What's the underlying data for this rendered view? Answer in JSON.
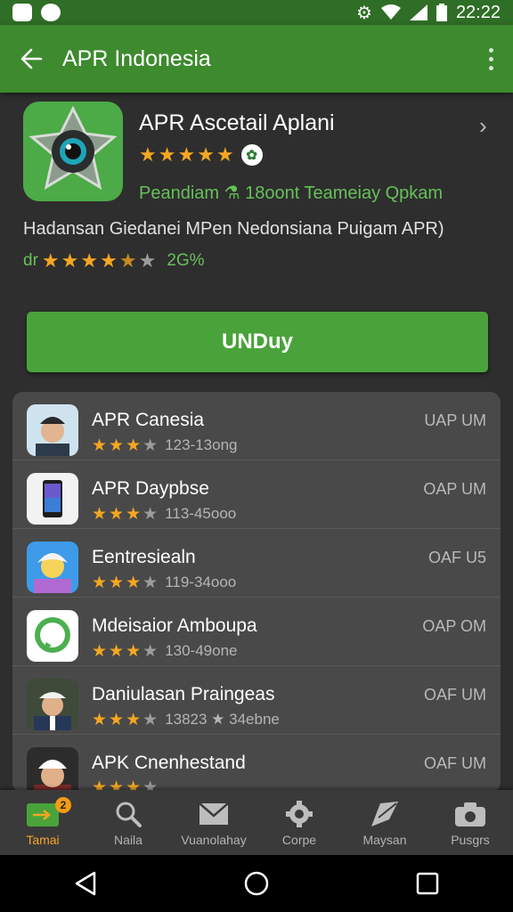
{
  "status_bar": {
    "time": "22:22"
  },
  "app_bar": {
    "title": "APR Indonesia"
  },
  "hero": {
    "title": "APR Ascetail Aplani",
    "rating_stars": 5,
    "badge": "✿",
    "meta": "Peandiam ⚗ 18oont  Teameiay Qpkam",
    "description": "Hadansan Giedanei MPen Nedonsiana Puigam  APR)",
    "rating_prefix": "dr",
    "rating_row_stars": 4.5,
    "rating_pct": "2G%"
  },
  "install_button": {
    "label": "UNDuy"
  },
  "list": [
    {
      "title": "APR Canesia",
      "stars": 3,
      "sub": "123-13ong",
      "right": "UAP UM",
      "icon": "person-cap-icon"
    },
    {
      "title": "APR Daypbse",
      "stars": 3,
      "sub": "113-45ooo",
      "right": "OAP UM",
      "icon": "smartphone-icon"
    },
    {
      "title": "Eentresiealn",
      "stars": 3,
      "sub": "119-34ooo",
      "right": "OAF U5",
      "icon": "avatar-cartoon-icon"
    },
    {
      "title": "Mdeisaior Amboupa",
      "stars": 3,
      "sub": "130-49one",
      "right": "OAP OM",
      "icon": "chat-bubble-icon"
    },
    {
      "title": "Daniulasan Praingeas",
      "stars": 3,
      "sub": "13823 ★ 34ebne",
      "right": "OAF UM",
      "icon": "person-hat-icon"
    },
    {
      "title": "APK Cnenhestand",
      "stars": 3,
      "sub": "",
      "right": "OAF UM",
      "icon": "person-white-cap-icon"
    }
  ],
  "bottom_nav": [
    {
      "label": "Tamai",
      "icon": "home-icon",
      "badge": "2",
      "active": true
    },
    {
      "label": "Naila",
      "icon": "search-icon"
    },
    {
      "label": "Vuanolahay",
      "icon": "mail-icon"
    },
    {
      "label": "Corpe",
      "icon": "gear-icon"
    },
    {
      "label": "Maysan",
      "icon": "arrow-icon"
    },
    {
      "label": "Pusgrs",
      "icon": "camera-icon"
    }
  ],
  "colors": {
    "accent": "#3e8a2f",
    "star": "#f5a623",
    "status_bar": "#2f6e26",
    "green_text": "#67c05a"
  }
}
